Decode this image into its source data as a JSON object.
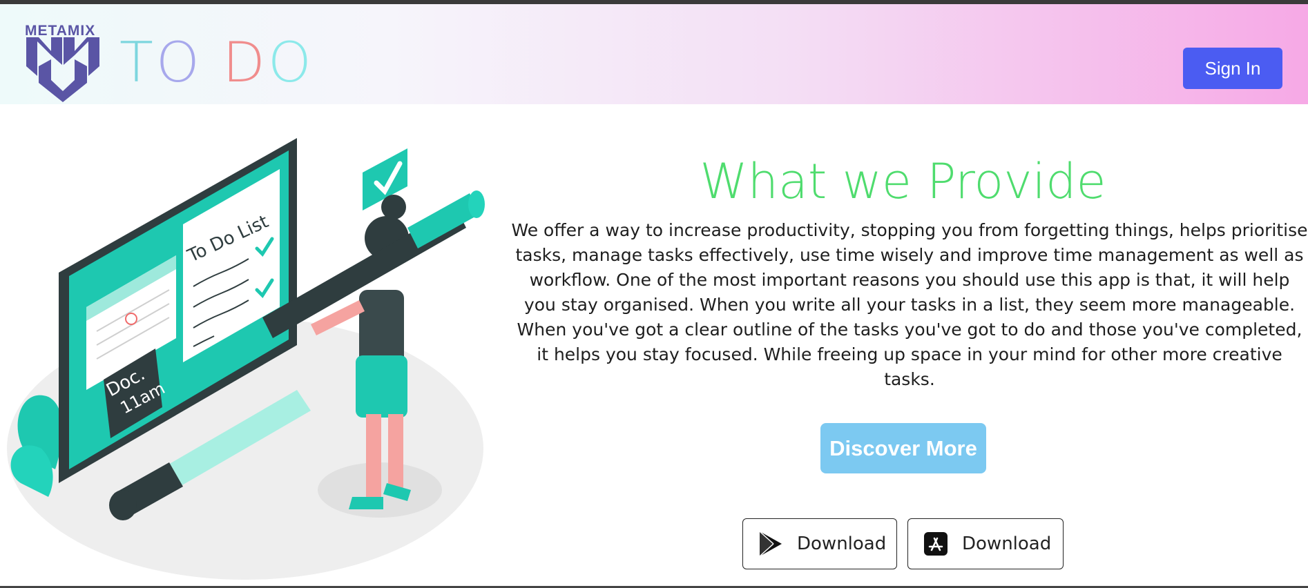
{
  "header": {
    "logo_word": "METAMIX",
    "brand_letters": [
      "T",
      "O",
      " ",
      "D",
      "O"
    ],
    "signin_label": "Sign In"
  },
  "hero": {
    "title": "What we Provide",
    "paragraph": "We offer a way to increase productivity, stopping you from forgetting things, helps prioritise tasks, manage tasks effectively, use time wisely and improve time management as well as workflow. One of the most important reasons you should use this app is that, it will help you stay organised. When you write all your tasks in a list, they seem more manageable. When you've got a clear outline of the tasks you've got to do and those you've completed, it helps you stay focused. While freeing up space in your mind for other more creative tasks.",
    "discover_label": "Discover More",
    "downloads": [
      {
        "label": "Download",
        "icon": "google-play-icon"
      },
      {
        "label": "Download",
        "icon": "app-store-icon"
      }
    ]
  },
  "illustration": {
    "board_title": "To Do List",
    "note_line1": "Doc.",
    "note_line2": "11am"
  },
  "colors": {
    "title_green": "#4fdc6e",
    "signin_blue": "#4b5cf2",
    "discover_blue": "#7cc9f1",
    "teal": "#1ec8b0"
  }
}
